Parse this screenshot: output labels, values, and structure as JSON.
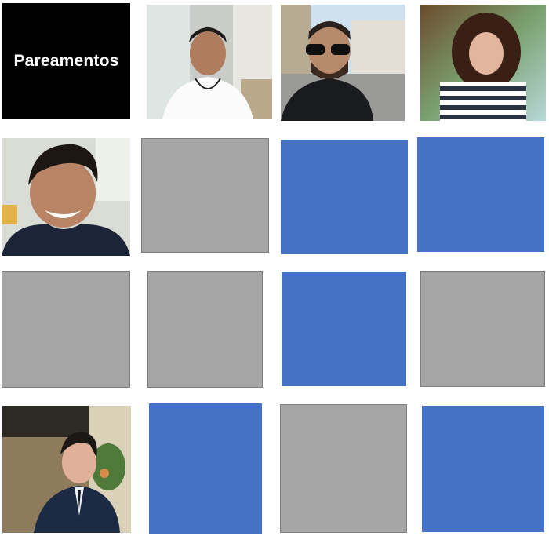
{
  "title": "Pareamentos",
  "colors": {
    "title_bg": "#000000",
    "title_text": "#ffffff",
    "gray_tile": "#a5a5a5",
    "gray_border": "#7f7f7f",
    "blue_tile": "#4472c4"
  },
  "grid": {
    "rows": [
      [
        "title",
        "photo-man-white-shirt",
        "photo-man-sunglasses",
        "photo-woman-curly-hair"
      ],
      [
        "photo-man-smiling-hoodie",
        "gray",
        "blue",
        "blue"
      ],
      [
        "gray",
        "gray",
        "blue",
        "gray"
      ],
      [
        "photo-man-suit",
        "blue",
        "gray",
        "blue"
      ]
    ]
  }
}
